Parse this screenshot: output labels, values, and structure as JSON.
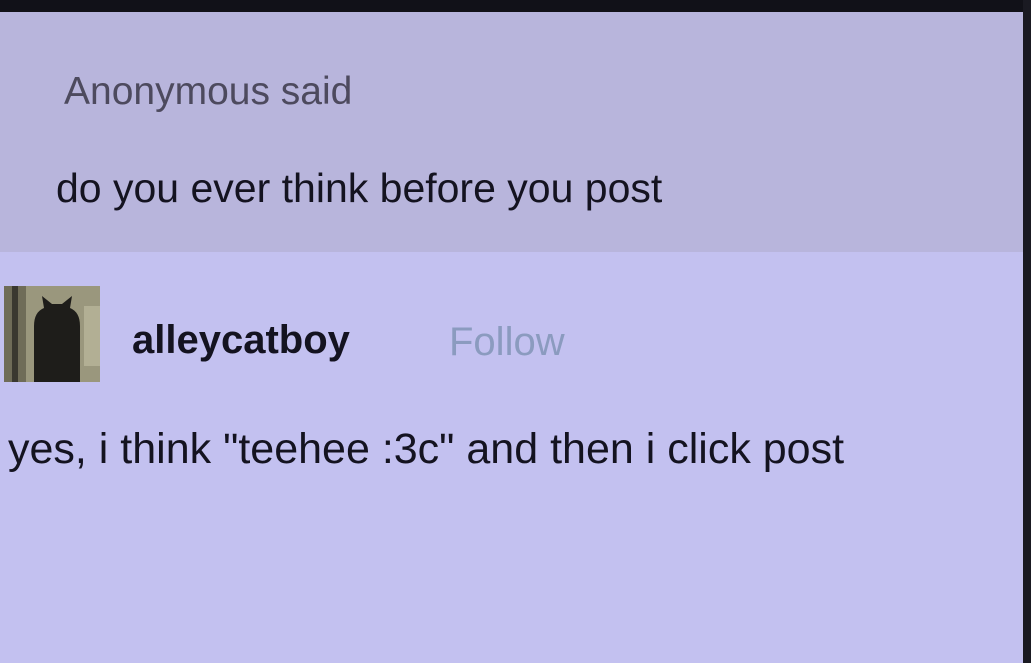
{
  "ask": {
    "asker_label": "Anonymous said",
    "question": "do you ever think before you post"
  },
  "answer": {
    "avatar_icon": "cat-avatar-icon",
    "username": "alleycatboy",
    "follow_label": "Follow",
    "reply": "yes, i think \"teehee :3c\" and then i click post"
  },
  "colors": {
    "page_background": "#c3c1f0",
    "ask_background": "#b8b5dc",
    "follow_link": "#8b9bbf",
    "text": "#141320"
  }
}
